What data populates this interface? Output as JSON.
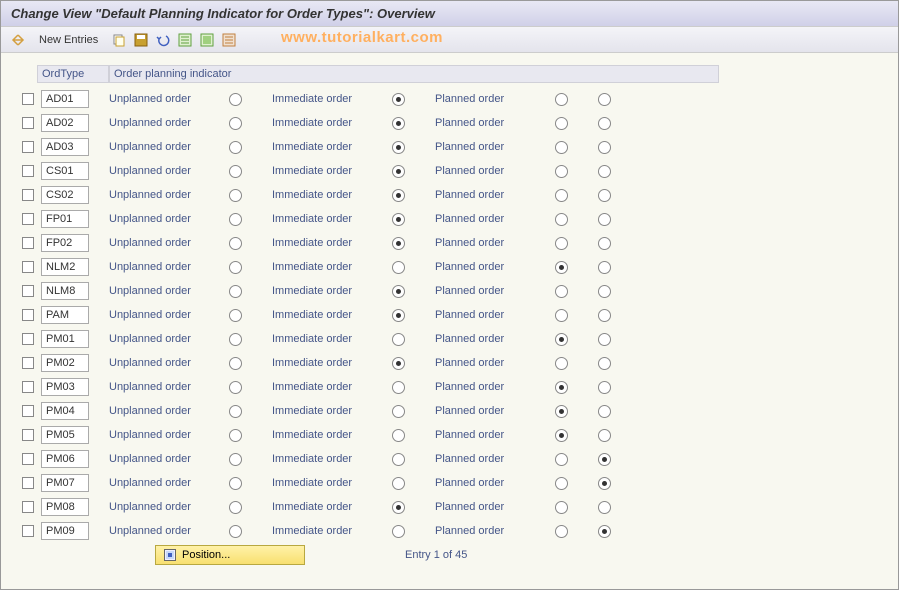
{
  "header": {
    "title": "Change View \"Default Planning Indicator for Order Types\": Overview"
  },
  "toolbar": {
    "new_entries": "New Entries"
  },
  "watermark": "www.tutorialkart.com",
  "table": {
    "col_ordtype": "OrdType",
    "col_indicator": "Order planning indicator",
    "option_labels": {
      "unplanned": "Unplanned order",
      "immediate": "Immediate order",
      "planned": "Planned order"
    },
    "rows": [
      {
        "ordtype": "AD01",
        "selected": 1
      },
      {
        "ordtype": "AD02",
        "selected": 1
      },
      {
        "ordtype": "AD03",
        "selected": 1
      },
      {
        "ordtype": "CS01",
        "selected": 1
      },
      {
        "ordtype": "CS02",
        "selected": 1
      },
      {
        "ordtype": "FP01",
        "selected": 1
      },
      {
        "ordtype": "FP02",
        "selected": 1
      },
      {
        "ordtype": "NLM2",
        "selected": 2
      },
      {
        "ordtype": "NLM8",
        "selected": 1
      },
      {
        "ordtype": "PAM",
        "selected": 1
      },
      {
        "ordtype": "PM01",
        "selected": 2
      },
      {
        "ordtype": "PM02",
        "selected": 1
      },
      {
        "ordtype": "PM03",
        "selected": 2
      },
      {
        "ordtype": "PM04",
        "selected": 2
      },
      {
        "ordtype": "PM05",
        "selected": 2
      },
      {
        "ordtype": "PM06",
        "selected": 3
      },
      {
        "ordtype": "PM07",
        "selected": 3
      },
      {
        "ordtype": "PM08",
        "selected": 1
      },
      {
        "ordtype": "PM09",
        "selected": 3
      }
    ]
  },
  "footer": {
    "position": "Position...",
    "entry_text": "Entry 1 of 45"
  }
}
